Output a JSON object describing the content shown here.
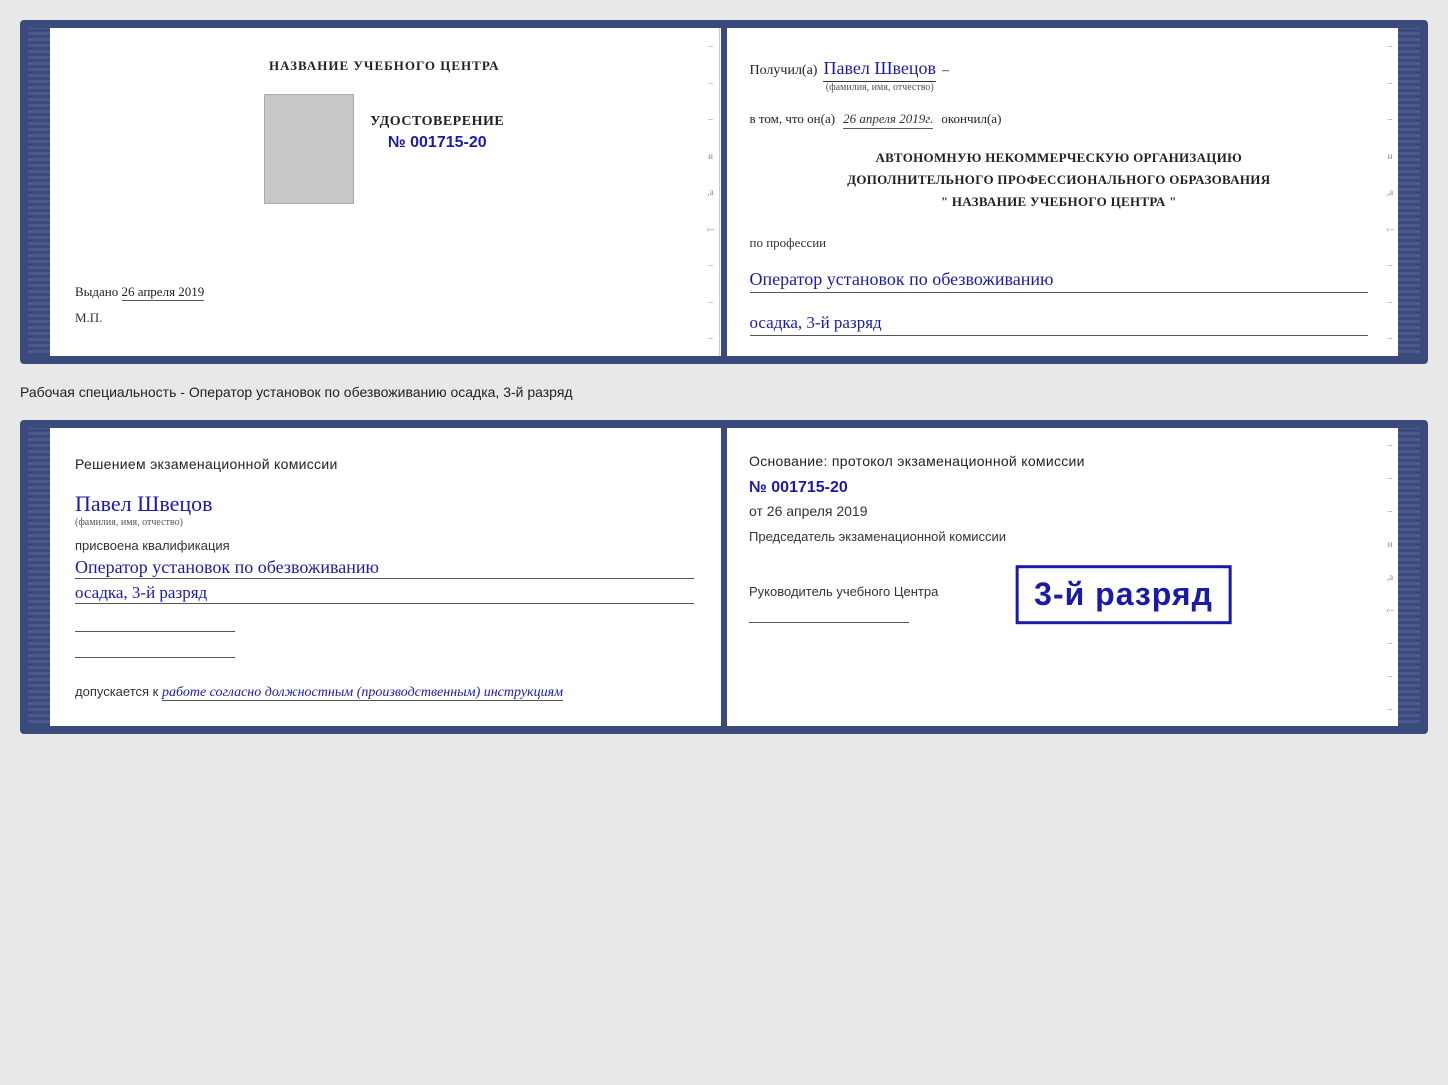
{
  "top_card": {
    "left": {
      "header": "НАЗВАНИЕ УЧЕБНОГО ЦЕНТРА",
      "cert_title": "УДОСТОВЕРЕНИЕ",
      "cert_number": "№ 001715-20",
      "issued_label": "Выдано",
      "issued_date": "26 апреля 2019",
      "mp_label": "М.П."
    },
    "right": {
      "received_label": "Получил(а)",
      "received_name": "Павел Швецов",
      "fio_label": "(фамилия, имя, отчество)",
      "dash": "–",
      "in_that_label": "в том, что он(а)",
      "date_value": "26 апреля 2019г.",
      "finished_label": "окончил(а)",
      "org_line1": "АВТОНОМНУЮ НЕКОММЕРЧЕСКУЮ ОРГАНИЗАЦИЮ",
      "org_line2": "ДОПОЛНИТЕЛЬНОГО ПРОФЕССИОНАЛЬНОГО ОБРАЗОВАНИЯ",
      "org_line3": "\"   НАЗВАНИЕ УЧЕБНОГО ЦЕНТРА   \"",
      "profession_label": "по профессии",
      "profession_value": "Оператор установок по обезвоживанию",
      "speciality_value": "осадка, 3-й разряд"
    }
  },
  "separator": {
    "text": "Рабочая специальность - Оператор установок по обезвоживанию осадка, 3-й разряд"
  },
  "bottom_card": {
    "left": {
      "decision_label": "Решением экзаменационной комиссии",
      "person_name": "Павел Швецов",
      "fio_label": "(фамилия, имя, отчество)",
      "assigned_label": "присвоена квалификация",
      "profession_value": "Оператор установок по обезвоживанию",
      "speciality_value": "осадка, 3-й разряд",
      "допускается_label": "допускается к",
      "допускается_value": "работе согласно должностным (производственным) инструкциям"
    },
    "right": {
      "osnование_label": "Основание: протокол экзаменационной комиссии",
      "protocol_number": "№  001715-20",
      "ot_label": "от",
      "ot_date": "26 апреля 2019",
      "predsed_label": "Председатель экзаменационной комиссии",
      "stamp_text": "3-й разряд",
      "rukovoditel_label": "Руководитель учебного Центра"
    }
  }
}
